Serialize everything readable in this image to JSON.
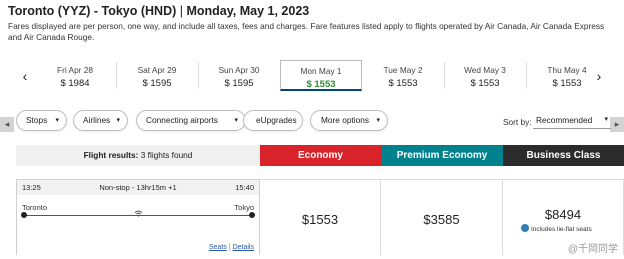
{
  "header": {
    "route": "Toronto (YYZ) - Tokyo (HND)",
    "separator": "|",
    "date": "Monday, May 1, 2023",
    "disclaimer": "Fares displayed are per person, one way, and include all taxes, fees and charges. Fare features listed apply to flights operated by Air Canada, Air Canada Express and Air Canada Rouge."
  },
  "date_strip": {
    "prev_icon": "chevron-left-icon",
    "next_icon": "chevron-right-icon",
    "prev_glyph": "‹",
    "next_glyph": "›",
    "days": [
      {
        "label": "Fri Apr 28",
        "price": "$ 1984"
      },
      {
        "label": "Sat Apr 29",
        "price": "$ 1595"
      },
      {
        "label": "Sun Apr 30",
        "price": "$ 1595"
      },
      {
        "label": "Mon May 1",
        "price": "$ 1553",
        "selected": true
      },
      {
        "label": "Tue May 2",
        "price": "$ 1553"
      },
      {
        "label": "Wed May 3",
        "price": "$ 1553"
      },
      {
        "label": "Thu May 4",
        "price": "$ 1553"
      }
    ]
  },
  "filters": {
    "stops": "Stops",
    "airlines": "Airlines",
    "connecting": "Connecting airports",
    "eupgrades": "eUpgrades",
    "more": "More options",
    "chevron_glyph": "▾"
  },
  "side_tabs": {
    "left": "◂",
    "right": "▸"
  },
  "sort": {
    "label": "Sort by:",
    "value": "Recommended"
  },
  "results": {
    "label": "Flight results:",
    "count": "3 flights found"
  },
  "cabins": {
    "economy": "Economy",
    "premium": "Premium Economy",
    "business": "Business Class"
  },
  "flight": {
    "departure_time": "13:25",
    "arrival_time": "15:40",
    "stops_info": "Non-stop - 13hr15m +1",
    "origin": "Toronto",
    "destination": "Tokyo",
    "seats_link": "Seats",
    "details_link": "Details",
    "link_separator": "|",
    "prices": {
      "economy": "$1553",
      "premium": "$3585",
      "business": "$8494"
    },
    "business_note": "Includes lie-flat seats"
  },
  "watermark": "@千岡同学",
  "colors": {
    "economy": "#d8232a",
    "premium": "#00818e",
    "business": "#2b2b2b",
    "selected_price": "#2f8f2f",
    "link": "#2a5ba8"
  }
}
